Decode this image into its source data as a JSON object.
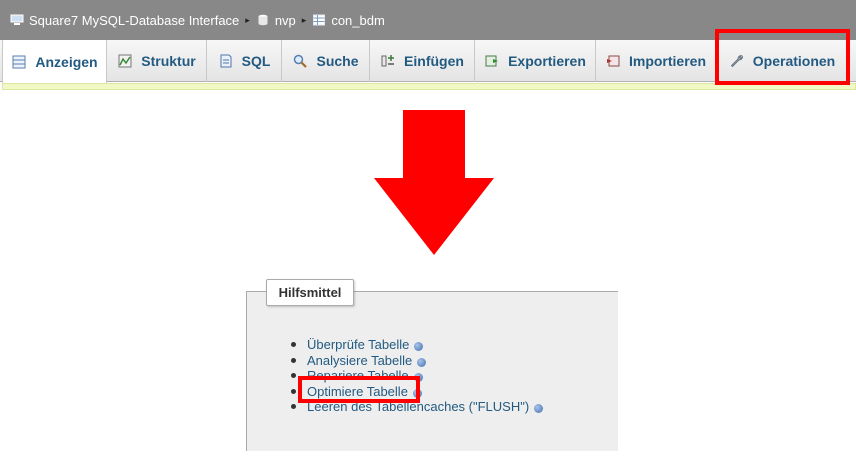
{
  "breadcrumb": {
    "server": "Square7 MySQL-Database Interface",
    "database": "nvp",
    "table": "con_bdm",
    "separator": "▸"
  },
  "tabs": [
    {
      "label": "Anzeigen",
      "icon": "browse-icon"
    },
    {
      "label": "Struktur",
      "icon": "structure-icon"
    },
    {
      "label": "SQL",
      "icon": "sql-icon"
    },
    {
      "label": "Suche",
      "icon": "search-icon"
    },
    {
      "label": "Einfügen",
      "icon": "insert-icon"
    },
    {
      "label": "Exportieren",
      "icon": "export-icon"
    },
    {
      "label": "Importieren",
      "icon": "import-icon"
    },
    {
      "label": "Operationen",
      "icon": "wrench-icon"
    }
  ],
  "active_tab": "Anzeigen",
  "highlight_color": "#ff0000",
  "maintenance": {
    "legend": "Hilfsmittel",
    "items": [
      {
        "label": "Überprüfe Tabelle"
      },
      {
        "label": "Analysiere Tabelle"
      },
      {
        "label": "Repariere Tabelle"
      },
      {
        "label": "Optimiere Tabelle"
      },
      {
        "label": "Leeren des Tabellencaches (\"FLUSH\")"
      }
    ]
  }
}
